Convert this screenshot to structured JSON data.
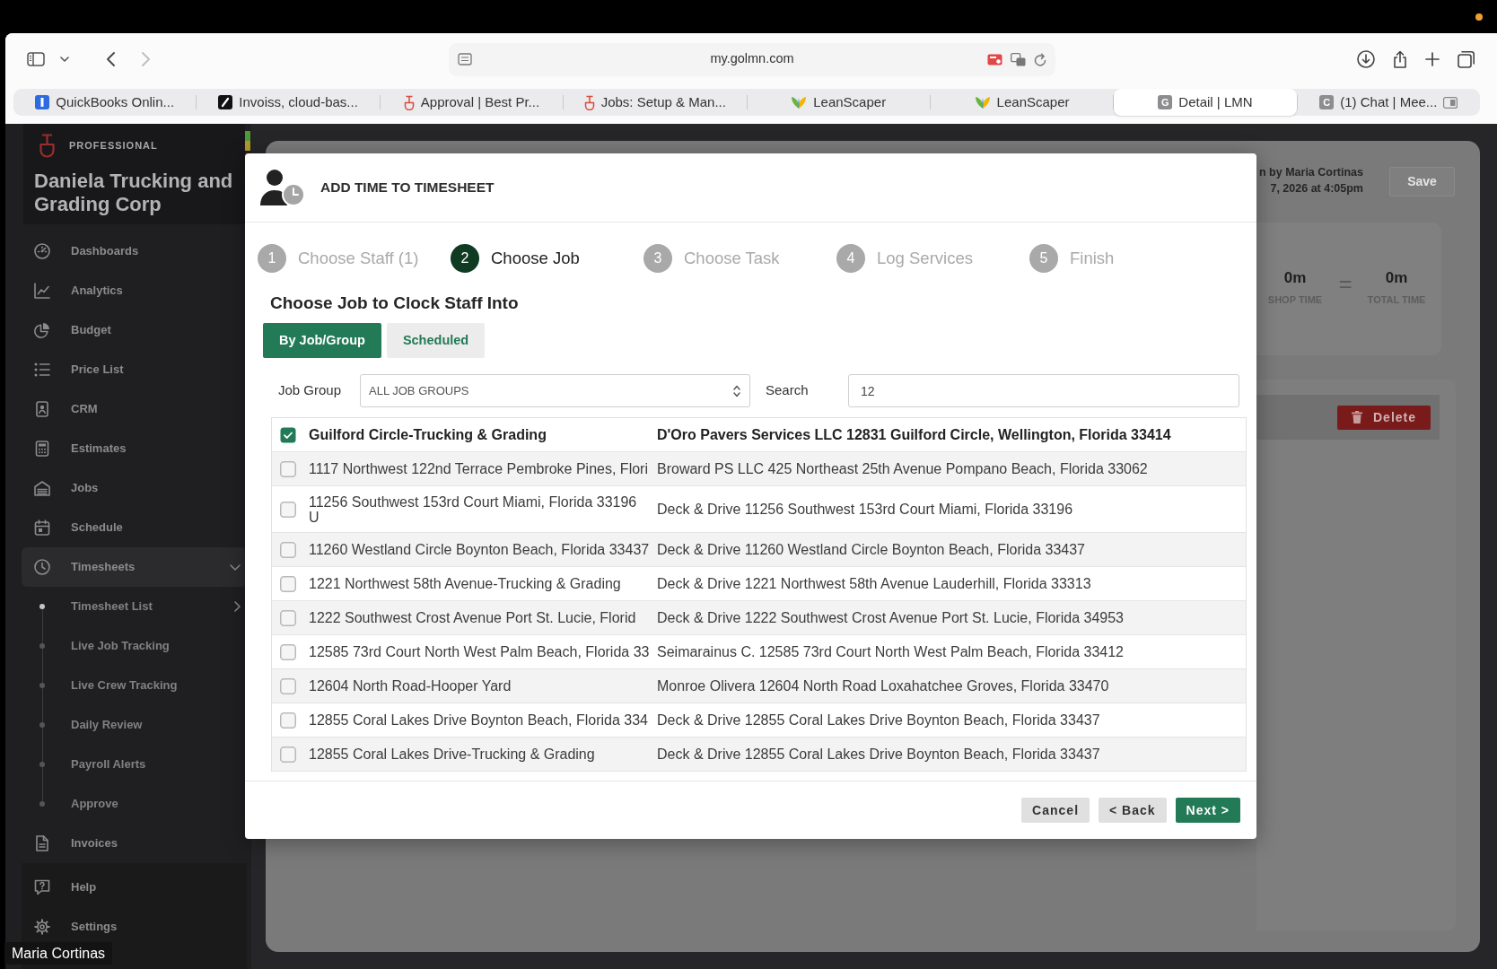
{
  "browser": {
    "url": "my.golmn.com",
    "tabs": [
      {
        "title": "QuickBooks Onlin...",
        "selected": false
      },
      {
        "title": "Invoiss, cloud-bas...",
        "selected": false
      },
      {
        "title": "Approval | Best Pr...",
        "selected": false
      },
      {
        "title": "Jobs: Setup & Man...",
        "selected": false
      },
      {
        "title": "LeanScaper",
        "selected": false
      },
      {
        "title": "LeanScaper",
        "selected": false
      },
      {
        "title": "Detail | LMN",
        "favicon_letter": "G",
        "selected": true
      },
      {
        "title": "(1) Chat | Mee...",
        "favicon_letter": "C",
        "selected": false
      }
    ]
  },
  "sidebar": {
    "plan": "PROFESSIONAL",
    "company": "Daniela Trucking and Grading Corp",
    "items": [
      {
        "label": "Dashboards",
        "selected": false
      },
      {
        "label": "Analytics",
        "selected": false
      },
      {
        "label": "Budget",
        "selected": false
      },
      {
        "label": "Price List",
        "selected": false
      },
      {
        "label": "CRM",
        "selected": false
      },
      {
        "label": "Estimates",
        "selected": false
      },
      {
        "label": "Jobs",
        "selected": false
      },
      {
        "label": "Schedule",
        "selected": false
      },
      {
        "label": "Timesheets",
        "selected": true,
        "expanded": true,
        "children": [
          {
            "label": "Timesheet List",
            "selected": true,
            "expanded": false
          },
          {
            "label": "Live Job Tracking",
            "selected": false
          },
          {
            "label": "Live Crew Tracking",
            "selected": false
          },
          {
            "label": "Daily Review",
            "selected": false
          },
          {
            "label": "Payroll Alerts",
            "selected": false
          },
          {
            "label": "Approve",
            "selected": false
          }
        ]
      },
      {
        "label": "Invoices",
        "selected": false
      }
    ],
    "footer_items": [
      {
        "label": "Help"
      },
      {
        "label": "Settings"
      }
    ]
  },
  "page": {
    "audit_lines": [
      "n by Maria Cortinas",
      "7, 2026 at 4:05pm"
    ],
    "save_button": {
      "label": "Save",
      "disabled": true
    },
    "totals": [
      {
        "value": "0m",
        "label": "SHOP TIME"
      },
      {
        "value": "0m",
        "label": "TOTAL TIME"
      }
    ],
    "totals_operator": "=",
    "delete_button": "Delete"
  },
  "modal": {
    "title": "ADD TIME TO TIMESHEET",
    "steps": [
      {
        "number": "1",
        "label": "Choose Staff (1)",
        "selected": false
      },
      {
        "number": "2",
        "label": "Choose Job",
        "selected": true
      },
      {
        "number": "3",
        "label": "Choose Task",
        "selected": false
      },
      {
        "number": "4",
        "label": "Log Services",
        "selected": false
      },
      {
        "number": "5",
        "label": "Finish",
        "selected": false
      }
    ],
    "heading": "Choose Job to Clock Staff Into",
    "view_tabs": [
      {
        "label": "By Job/Group",
        "selected": true
      },
      {
        "label": "Scheduled",
        "selected": false
      }
    ],
    "filters": [
      {
        "label": "Job Group",
        "kind": "select",
        "value": "ALL JOB GROUPS"
      },
      {
        "label": "Search",
        "kind": "text",
        "value": "12"
      }
    ],
    "jobs": [
      {
        "job_name": "Guilford Circle-Trucking & Grading",
        "client_and_address": "D'Oro Pavers Services LLC 12831 Guilford Circle, Wellington, Florida 33414",
        "checked": true
      },
      {
        "job_name": "1117 Northwest 122nd Terrace Pembroke Pines, Flori",
        "client_and_address": "Broward PS LLC 425 Northeast 25th Avenue Pompano Beach, Florida 33062",
        "checked": false
      },
      {
        "job_name": "11256 Southwest 153rd Court Miami, Florida 33196\nU",
        "client_and_address": "Deck & Drive 11256 Southwest 153rd Court Miami, Florida 33196",
        "checked": false
      },
      {
        "job_name": "11260 Westland Circle Boynton Beach, Florida 33437",
        "client_and_address": "Deck & Drive 11260 Westland Circle Boynton Beach, Florida 33437",
        "checked": false
      },
      {
        "job_name": "1221 Northwest 58th Avenue-Trucking & Grading",
        "client_and_address": "Deck & Drive 1221 Northwest 58th Avenue Lauderhill, Florida 33313",
        "checked": false
      },
      {
        "job_name": "1222 Southwest Crost Avenue Port St. Lucie, Florid",
        "client_and_address": "Deck & Drive 1222 Southwest Crost Avenue Port St. Lucie, Florida 34953",
        "checked": false
      },
      {
        "job_name": "12585 73rd Court North West Palm Beach, Florida 33",
        "client_and_address": "Seimarainus C. 12585 73rd Court North West Palm Beach, Florida 33412",
        "checked": false
      },
      {
        "job_name": "12604 North Road-Hooper Yard",
        "client_and_address": "Monroe Olivera 12604 North Road Loxahatchee Groves, Florida 33470",
        "checked": false
      },
      {
        "job_name": "12855 Coral Lakes Drive Boynton Beach, Florida 334",
        "client_and_address": "Deck & Drive 12855 Coral Lakes Drive Boynton Beach, Florida 33437",
        "checked": false
      },
      {
        "job_name": "12855 Coral Lakes Drive-Trucking & Grading",
        "client_and_address": "Deck & Drive 12855 Coral Lakes Drive Boynton Beach, Florida 33437",
        "checked": false
      }
    ],
    "buttons": [
      {
        "label": "Cancel",
        "kind": "secondary"
      },
      {
        "label": "< Back",
        "kind": "secondary"
      },
      {
        "label": "Next >",
        "kind": "primary"
      }
    ]
  },
  "video_call": {
    "participant": "Maria Cortinas"
  }
}
